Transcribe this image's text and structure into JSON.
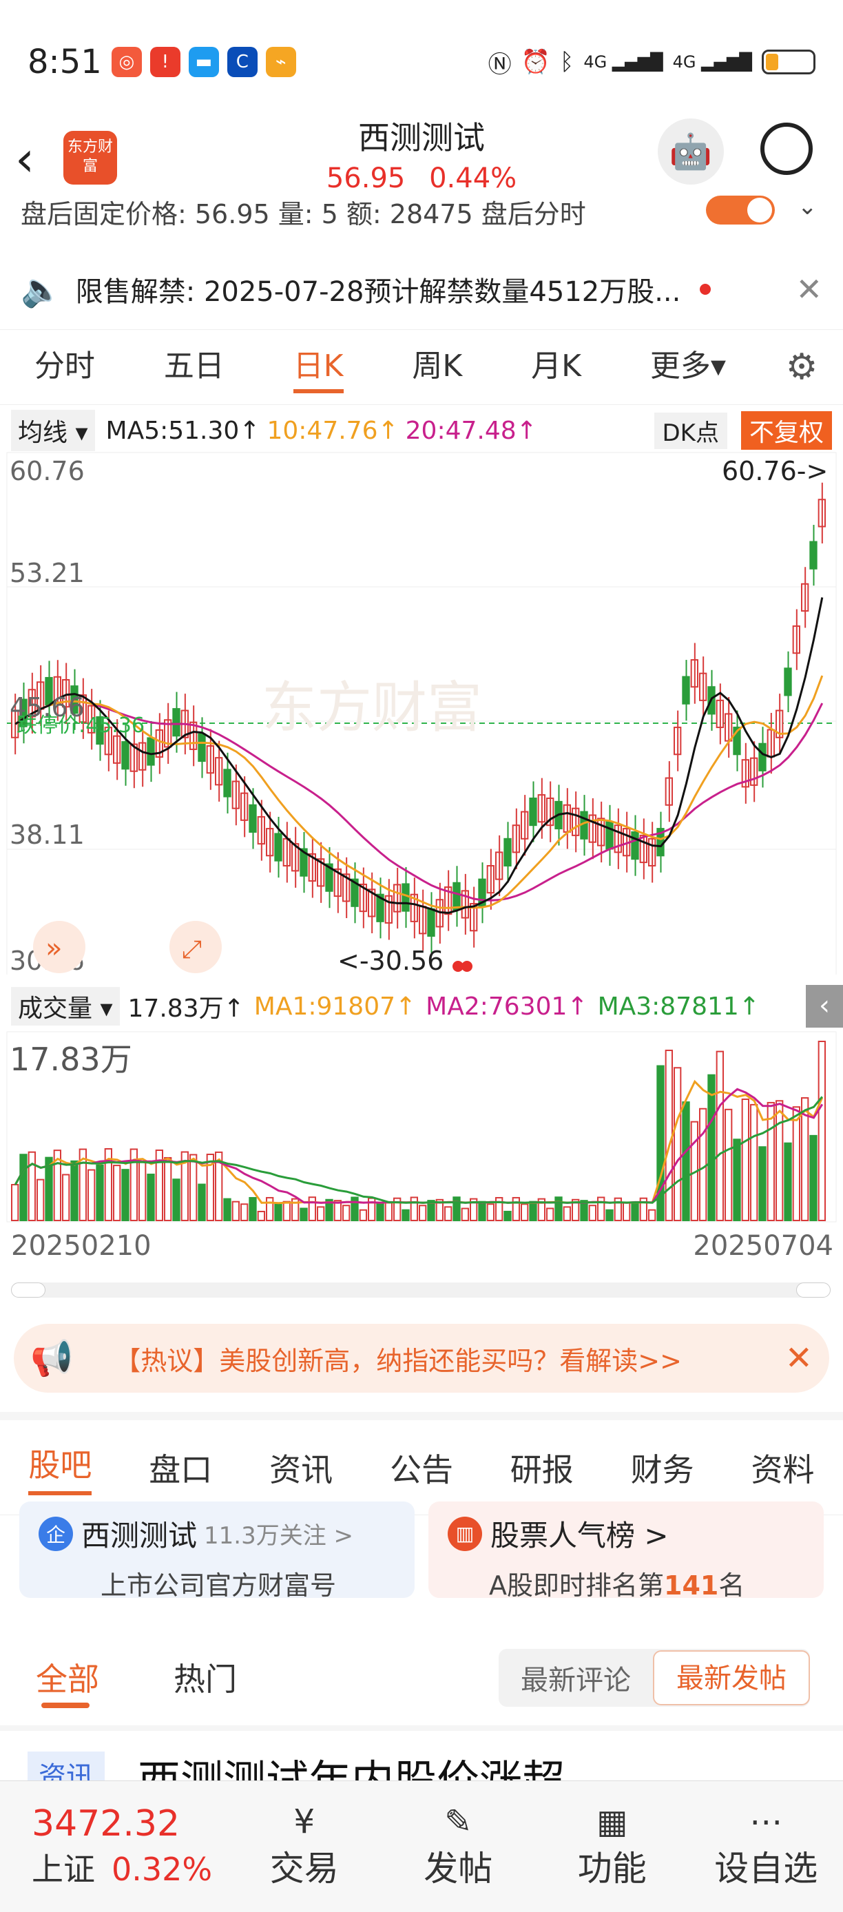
{
  "status": {
    "time": "8:51",
    "signal": "4G",
    "signal2": "4G"
  },
  "header": {
    "title": "西测测试",
    "price": "56.95",
    "change": "0.44%",
    "logo_text": "东方财富"
  },
  "ticker": {
    "text": "盘后固定价格: 56.95  量: 5  额: 28475  盘后分时"
  },
  "notice": {
    "text": "限售解禁: 2025-07-28预计解禁数量4512万股..."
  },
  "tabs": [
    "分时",
    "五日",
    "日K",
    "周K",
    "月K",
    "更多▾"
  ],
  "active_tab": 2,
  "ma": {
    "selector": "均线",
    "ma5": "MA5:51.30↑",
    "ma10": "10:47.76↑",
    "ma20": "20:47.48↑",
    "dk": "DK点",
    "fq": "不复权"
  },
  "chart": {
    "y_top": "60.76",
    "y2": "53.21",
    "y3": "45.66",
    "y4": "38.11",
    "y_bottom": "30.56",
    "max_label": "60.76->",
    "min_label": "<-30.56",
    "break_price": "跌停价:45.36",
    "watermark": "东方财富"
  },
  "volume": {
    "selector": "成交量",
    "current": "17.83万↑",
    "ma1": "MA1:91807↑",
    "ma2": "MA2:76301↑",
    "ma3": "MA3:87811↑",
    "max": "17.83万",
    "date_start": "20250210",
    "date_end": "20250704"
  },
  "hot": {
    "text": "【热议】美股创新高，纳指还能买吗？看解读>>"
  },
  "subtabs": [
    "股吧",
    "盘口",
    "资讯",
    "公告",
    "研报",
    "财务",
    "资料"
  ],
  "card_left": {
    "title": "西测测试",
    "follow": "11.3万关注 >",
    "sub": "上市公司官方财富号"
  },
  "card_right": {
    "title": "股票人气榜 >",
    "sub_prefix": "A股即时排名第",
    "rank": "141",
    "sub_suffix": "名"
  },
  "feed": {
    "tab_all": "全部",
    "tab_hot": "热门",
    "latest_comment": "最新评论",
    "latest_post": "最新发帖",
    "news_tag": "资讯",
    "news_title": "西测测试年内股价涨超"
  },
  "bottom": {
    "index_value": "3472.32",
    "index_name": "上证",
    "index_change": "0.32%",
    "trade": "交易",
    "post": "发帖",
    "function": "功能",
    "watch": "设自选"
  },
  "chart_data": {
    "type": "candlestick",
    "x_range": [
      "20250210",
      "20250704"
    ],
    "ylim": [
      30.56,
      60.76
    ],
    "y_ticks": [
      60.76,
      53.21,
      45.66,
      38.11,
      30.56
    ],
    "annotations": {
      "max": 60.76,
      "min": 30.56,
      "limit_down": 45.36
    },
    "ma": {
      "MA5": 51.3,
      "MA10": 47.76,
      "MA20": 47.48
    },
    "volume": {
      "max": "17.83万",
      "MA1": 91807,
      "MA2": 76301,
      "MA3": 87811
    }
  }
}
